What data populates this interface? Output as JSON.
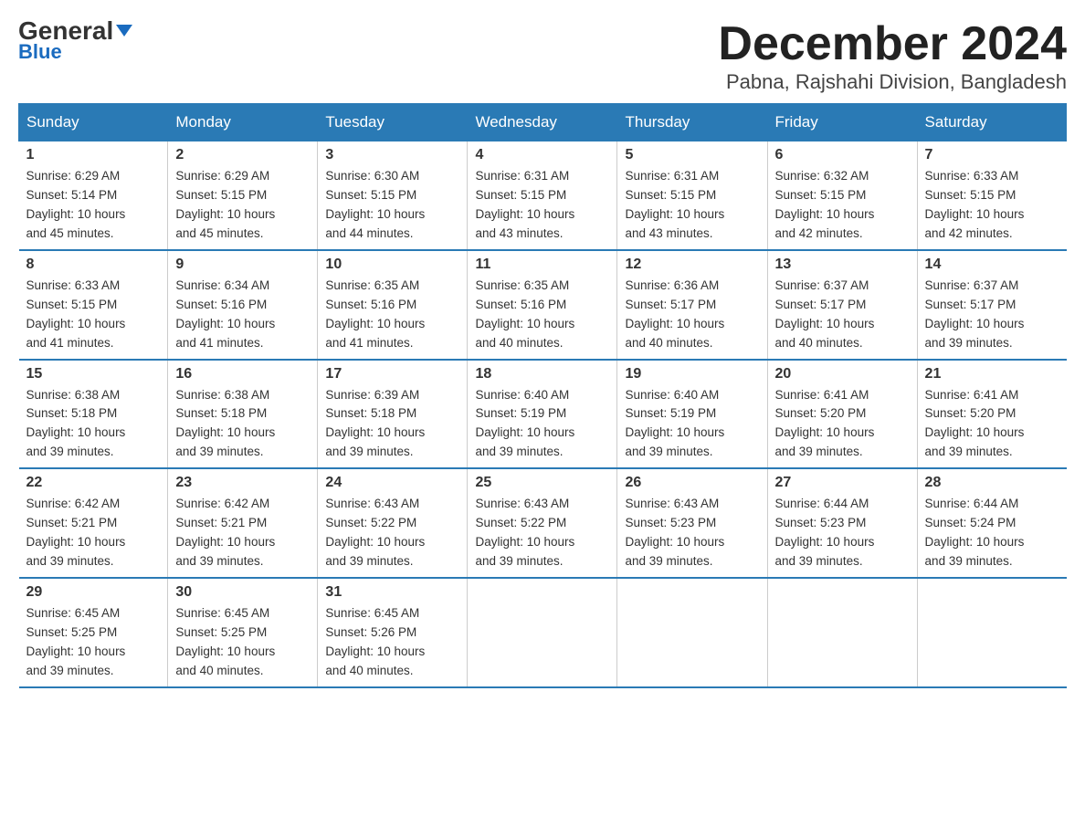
{
  "header": {
    "logo_general": "General",
    "logo_blue": "Blue",
    "month_title": "December 2024",
    "location": "Pabna, Rajshahi Division, Bangladesh"
  },
  "days_of_week": [
    "Sunday",
    "Monday",
    "Tuesday",
    "Wednesday",
    "Thursday",
    "Friday",
    "Saturday"
  ],
  "weeks": [
    [
      {
        "day": "1",
        "sunrise": "6:29 AM",
        "sunset": "5:14 PM",
        "daylight": "10 hours and 45 minutes."
      },
      {
        "day": "2",
        "sunrise": "6:29 AM",
        "sunset": "5:15 PM",
        "daylight": "10 hours and 45 minutes."
      },
      {
        "day": "3",
        "sunrise": "6:30 AM",
        "sunset": "5:15 PM",
        "daylight": "10 hours and 44 minutes."
      },
      {
        "day": "4",
        "sunrise": "6:31 AM",
        "sunset": "5:15 PM",
        "daylight": "10 hours and 43 minutes."
      },
      {
        "day": "5",
        "sunrise": "6:31 AM",
        "sunset": "5:15 PM",
        "daylight": "10 hours and 43 minutes."
      },
      {
        "day": "6",
        "sunrise": "6:32 AM",
        "sunset": "5:15 PM",
        "daylight": "10 hours and 42 minutes."
      },
      {
        "day": "7",
        "sunrise": "6:33 AM",
        "sunset": "5:15 PM",
        "daylight": "10 hours and 42 minutes."
      }
    ],
    [
      {
        "day": "8",
        "sunrise": "6:33 AM",
        "sunset": "5:15 PM",
        "daylight": "10 hours and 41 minutes."
      },
      {
        "day": "9",
        "sunrise": "6:34 AM",
        "sunset": "5:16 PM",
        "daylight": "10 hours and 41 minutes."
      },
      {
        "day": "10",
        "sunrise": "6:35 AM",
        "sunset": "5:16 PM",
        "daylight": "10 hours and 41 minutes."
      },
      {
        "day": "11",
        "sunrise": "6:35 AM",
        "sunset": "5:16 PM",
        "daylight": "10 hours and 40 minutes."
      },
      {
        "day": "12",
        "sunrise": "6:36 AM",
        "sunset": "5:17 PM",
        "daylight": "10 hours and 40 minutes."
      },
      {
        "day": "13",
        "sunrise": "6:37 AM",
        "sunset": "5:17 PM",
        "daylight": "10 hours and 40 minutes."
      },
      {
        "day": "14",
        "sunrise": "6:37 AM",
        "sunset": "5:17 PM",
        "daylight": "10 hours and 39 minutes."
      }
    ],
    [
      {
        "day": "15",
        "sunrise": "6:38 AM",
        "sunset": "5:18 PM",
        "daylight": "10 hours and 39 minutes."
      },
      {
        "day": "16",
        "sunrise": "6:38 AM",
        "sunset": "5:18 PM",
        "daylight": "10 hours and 39 minutes."
      },
      {
        "day": "17",
        "sunrise": "6:39 AM",
        "sunset": "5:18 PM",
        "daylight": "10 hours and 39 minutes."
      },
      {
        "day": "18",
        "sunrise": "6:40 AM",
        "sunset": "5:19 PM",
        "daylight": "10 hours and 39 minutes."
      },
      {
        "day": "19",
        "sunrise": "6:40 AM",
        "sunset": "5:19 PM",
        "daylight": "10 hours and 39 minutes."
      },
      {
        "day": "20",
        "sunrise": "6:41 AM",
        "sunset": "5:20 PM",
        "daylight": "10 hours and 39 minutes."
      },
      {
        "day": "21",
        "sunrise": "6:41 AM",
        "sunset": "5:20 PM",
        "daylight": "10 hours and 39 minutes."
      }
    ],
    [
      {
        "day": "22",
        "sunrise": "6:42 AM",
        "sunset": "5:21 PM",
        "daylight": "10 hours and 39 minutes."
      },
      {
        "day": "23",
        "sunrise": "6:42 AM",
        "sunset": "5:21 PM",
        "daylight": "10 hours and 39 minutes."
      },
      {
        "day": "24",
        "sunrise": "6:43 AM",
        "sunset": "5:22 PM",
        "daylight": "10 hours and 39 minutes."
      },
      {
        "day": "25",
        "sunrise": "6:43 AM",
        "sunset": "5:22 PM",
        "daylight": "10 hours and 39 minutes."
      },
      {
        "day": "26",
        "sunrise": "6:43 AM",
        "sunset": "5:23 PM",
        "daylight": "10 hours and 39 minutes."
      },
      {
        "day": "27",
        "sunrise": "6:44 AM",
        "sunset": "5:23 PM",
        "daylight": "10 hours and 39 minutes."
      },
      {
        "day": "28",
        "sunrise": "6:44 AM",
        "sunset": "5:24 PM",
        "daylight": "10 hours and 39 minutes."
      }
    ],
    [
      {
        "day": "29",
        "sunrise": "6:45 AM",
        "sunset": "5:25 PM",
        "daylight": "10 hours and 39 minutes."
      },
      {
        "day": "30",
        "sunrise": "6:45 AM",
        "sunset": "5:25 PM",
        "daylight": "10 hours and 40 minutes."
      },
      {
        "day": "31",
        "sunrise": "6:45 AM",
        "sunset": "5:26 PM",
        "daylight": "10 hours and 40 minutes."
      },
      null,
      null,
      null,
      null
    ]
  ],
  "labels": {
    "sunrise": "Sunrise:",
    "sunset": "Sunset:",
    "daylight": "Daylight:"
  }
}
